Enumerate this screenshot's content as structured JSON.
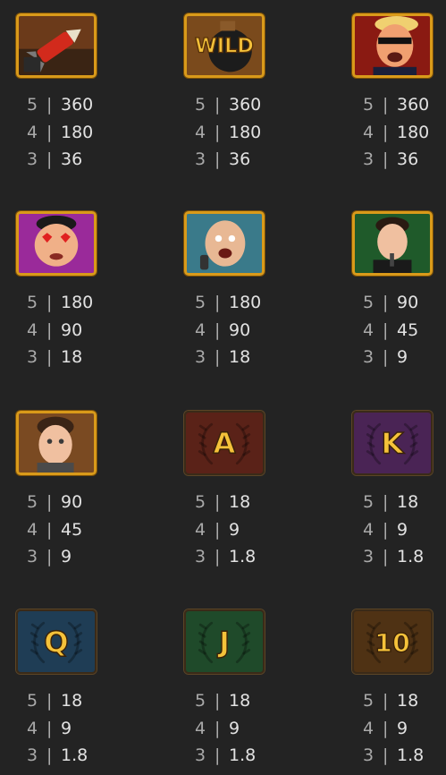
{
  "paytable": {
    "symbols": [
      {
        "id": "missile",
        "type": "picture",
        "pays": [
          {
            "count": "5",
            "value": "360"
          },
          {
            "count": "4",
            "value": "180"
          },
          {
            "count": "3",
            "value": "36"
          }
        ]
      },
      {
        "id": "wild",
        "type": "wild",
        "letter": "WILD",
        "pays": [
          {
            "count": "5",
            "value": "360"
          },
          {
            "count": "4",
            "value": "180"
          },
          {
            "count": "3",
            "value": "36"
          }
        ]
      },
      {
        "id": "trump",
        "type": "picture",
        "pays": [
          {
            "count": "5",
            "value": "360"
          },
          {
            "count": "4",
            "value": "180"
          },
          {
            "count": "3",
            "value": "36"
          }
        ]
      },
      {
        "id": "kim",
        "type": "picture",
        "pays": [
          {
            "count": "5",
            "value": "180"
          },
          {
            "count": "4",
            "value": "90"
          },
          {
            "count": "3",
            "value": "18"
          }
        ]
      },
      {
        "id": "putin",
        "type": "picture",
        "pays": [
          {
            "count": "5",
            "value": "180"
          },
          {
            "count": "4",
            "value": "90"
          },
          {
            "count": "3",
            "value": "18"
          }
        ]
      },
      {
        "id": "musk",
        "type": "picture",
        "pays": [
          {
            "count": "5",
            "value": "90"
          },
          {
            "count": "4",
            "value": "45"
          },
          {
            "count": "3",
            "value": "9"
          }
        ]
      },
      {
        "id": "zuckerberg",
        "type": "picture",
        "pays": [
          {
            "count": "5",
            "value": "90"
          },
          {
            "count": "4",
            "value": "45"
          },
          {
            "count": "3",
            "value": "9"
          }
        ]
      },
      {
        "id": "ace",
        "type": "card",
        "letter": "A",
        "bg": "#5a2218",
        "pays": [
          {
            "count": "5",
            "value": "18"
          },
          {
            "count": "4",
            "value": "9"
          },
          {
            "count": "3",
            "value": "1.8"
          }
        ]
      },
      {
        "id": "king",
        "type": "card",
        "letter": "K",
        "bg": "#4a2455",
        "pays": [
          {
            "count": "5",
            "value": "18"
          },
          {
            "count": "4",
            "value": "9"
          },
          {
            "count": "3",
            "value": "1.8"
          }
        ]
      },
      {
        "id": "queen",
        "type": "card",
        "letter": "Q",
        "bg": "#1f3d55",
        "pays": [
          {
            "count": "5",
            "value": "18"
          },
          {
            "count": "4",
            "value": "9"
          },
          {
            "count": "3",
            "value": "1.8"
          }
        ]
      },
      {
        "id": "jack",
        "type": "card",
        "letter": "J",
        "bg": "#1f4a2a",
        "pays": [
          {
            "count": "5",
            "value": "18"
          },
          {
            "count": "4",
            "value": "9"
          },
          {
            "count": "3",
            "value": "1.8"
          }
        ]
      },
      {
        "id": "ten",
        "type": "card",
        "letter": "10",
        "bg": "#4f3214",
        "pays": [
          {
            "count": "5",
            "value": "18"
          },
          {
            "count": "4",
            "value": "9"
          },
          {
            "count": "3",
            "value": "1.8"
          }
        ]
      }
    ],
    "separator": "|"
  },
  "colors": {
    "background": "#232323",
    "gold_frame": "#d99a1a",
    "letter_gold": "#f5c23a"
  }
}
